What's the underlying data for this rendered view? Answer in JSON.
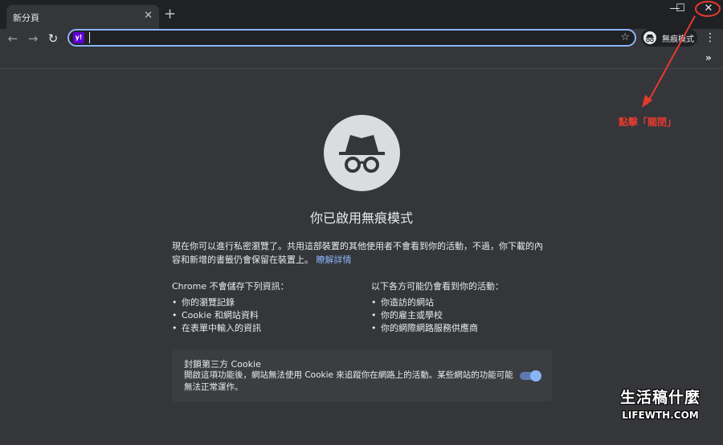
{
  "tab": {
    "title": "新分頁",
    "close": "✕",
    "new_tab": "+"
  },
  "window": {
    "minimize": "—",
    "maximize": "☐",
    "close": "✕"
  },
  "toolbar": {
    "back": "←",
    "forward": "→",
    "reload": "↻",
    "search_badge": "y!",
    "address_value": "",
    "star": "☆",
    "incognito_label": "無痕模式",
    "menu": "⋮"
  },
  "bookmarks": {
    "overflow": "»"
  },
  "main": {
    "heading": "你已啟用無痕模式",
    "intro": "現在你可以進行私密瀏覽了。共用這部裝置的其他使用者不會看到你的活動，不過，你下載的內容和新增的書籤仍會保留在裝置上。",
    "learn_more": "瞭解詳情",
    "left_col": {
      "title": "Chrome 不會儲存下列資訊：",
      "items": [
        "你的瀏覽記錄",
        "Cookie 和網站資料",
        "在表單中輸入的資訊"
      ]
    },
    "right_col": {
      "title": "以下各方可能仍會看到你的活動：",
      "items": [
        "你造訪的網站",
        "你的雇主或學校",
        "你的網際網路服務供應商"
      ]
    },
    "cookie": {
      "title": "封鎖第三方 Cookie",
      "desc": "開啟這項功能後，網站無法使用 Cookie 來追蹤你在網路上的活動。某些網站的功能可能無法正常運作。",
      "toggle_on": true
    }
  },
  "annotation": {
    "text": "點擊「關閉」",
    "color": "#e33a2f"
  },
  "watermark": {
    "cn": "生活稿什麼",
    "en": "LIFEWTH.COM"
  },
  "colors": {
    "accent": "#8ab4f8",
    "background": "#35363a",
    "tabstrip": "#202124"
  }
}
